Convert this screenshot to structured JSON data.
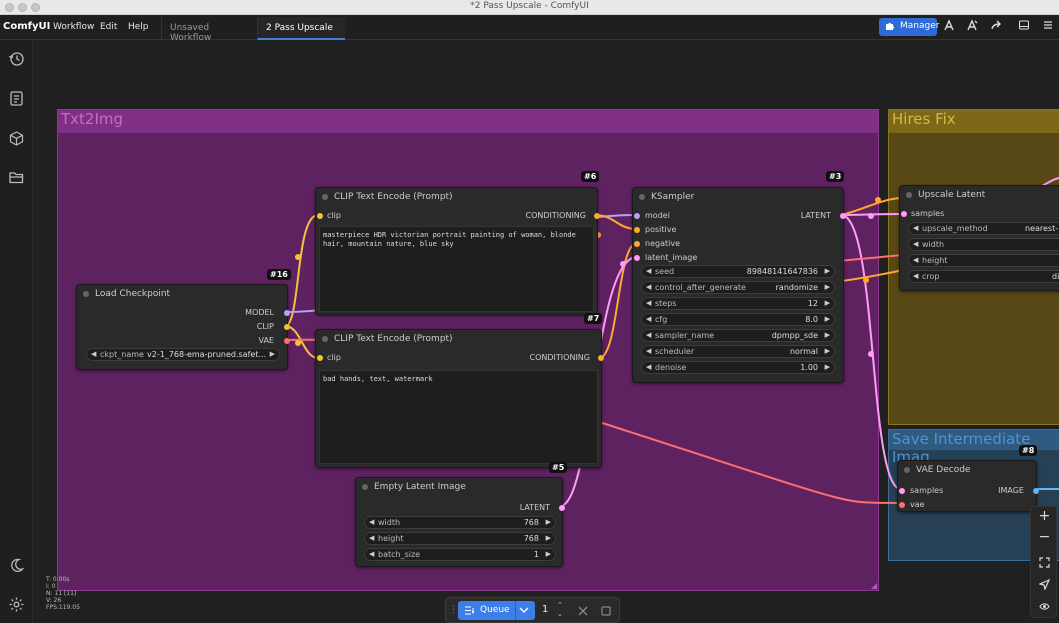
{
  "window": {
    "title": "*2 Pass Upscale - ComfyUI"
  },
  "app": {
    "brand": "ComfyUI"
  },
  "menu": {
    "workflow": "Workflow",
    "edit": "Edit",
    "help": "Help"
  },
  "tabs": [
    {
      "label": "Unsaved Workflow"
    },
    {
      "label": "2 Pass Upscale"
    }
  ],
  "toolbar": {
    "manager_label": "Manager"
  },
  "groups": {
    "txt2img": "Txt2Img",
    "hires": "Hires Fix",
    "save": "Save Intermediate Imag"
  },
  "nodes": {
    "load_checkpoint": {
      "id": "#16",
      "title": "Load Checkpoint",
      "outputs": [
        "MODEL",
        "CLIP",
        "VAE"
      ],
      "ckpt_label": "ckpt_name",
      "ckpt_value": "v2-1_768-ema-pruned.safet..."
    },
    "clip_pos": {
      "id": "#6",
      "title": "CLIP Text Encode (Prompt)",
      "input": "clip",
      "output": "CONDITIONING",
      "text": "masterpiece HDR victorian portrait painting of woman, blonde hair, mountain nature, blue sky"
    },
    "clip_neg": {
      "id": "#7",
      "title": "CLIP Text Encode (Prompt)",
      "input": "clip",
      "output": "CONDITIONING",
      "text": "bad hands, text, watermark"
    },
    "ksampler": {
      "id": "#3",
      "title": "KSampler",
      "inputs": [
        "model",
        "positive",
        "negative",
        "latent_image"
      ],
      "output": "LATENT",
      "widgets": [
        {
          "label": "seed",
          "value": "89848141647836"
        },
        {
          "label": "control_after_generate",
          "value": "randomize"
        },
        {
          "label": "steps",
          "value": "12"
        },
        {
          "label": "cfg",
          "value": "8.0"
        },
        {
          "label": "sampler_name",
          "value": "dpmpp_sde"
        },
        {
          "label": "scheduler",
          "value": "normal"
        },
        {
          "label": "denoise",
          "value": "1.00"
        }
      ]
    },
    "empty_latent": {
      "id": "#5",
      "title": "Empty Latent Image",
      "output": "LATENT",
      "widgets": [
        {
          "label": "width",
          "value": "768"
        },
        {
          "label": "height",
          "value": "768"
        },
        {
          "label": "batch_size",
          "value": "1"
        }
      ]
    },
    "upscale_latent": {
      "title": "Upscale Latent",
      "input": "samples",
      "widgets": [
        {
          "label": "upscale_method",
          "value": "nearest-"
        },
        {
          "label": "width",
          "value": ""
        },
        {
          "label": "height",
          "value": ""
        },
        {
          "label": "crop",
          "value": "disa"
        }
      ]
    },
    "vae_decode": {
      "id": "#8",
      "title": "VAE Decode",
      "inputs": [
        "samples",
        "vae"
      ],
      "output": "IMAGE"
    }
  },
  "stats": {
    "t": "T: 0.00s",
    "i": "I: 0",
    "n": "N: 11 [11]",
    "v": "V: 26",
    "fps": "FPS:119.05"
  },
  "queue": {
    "label": "Queue",
    "count": "1"
  },
  "colors": {
    "accent": "#3d7ee8",
    "txt2img_group": "#b249b7",
    "hires_group": "#a8881f",
    "save_group": "#3a79b5",
    "wire_model": "#b3a0ff",
    "wire_clip": "#f6c338",
    "wire_vae": "#ff6e6e",
    "wire_conditioning": "#ffa931",
    "wire_latent": "#ff9cf9",
    "wire_image": "#64b5f6"
  }
}
